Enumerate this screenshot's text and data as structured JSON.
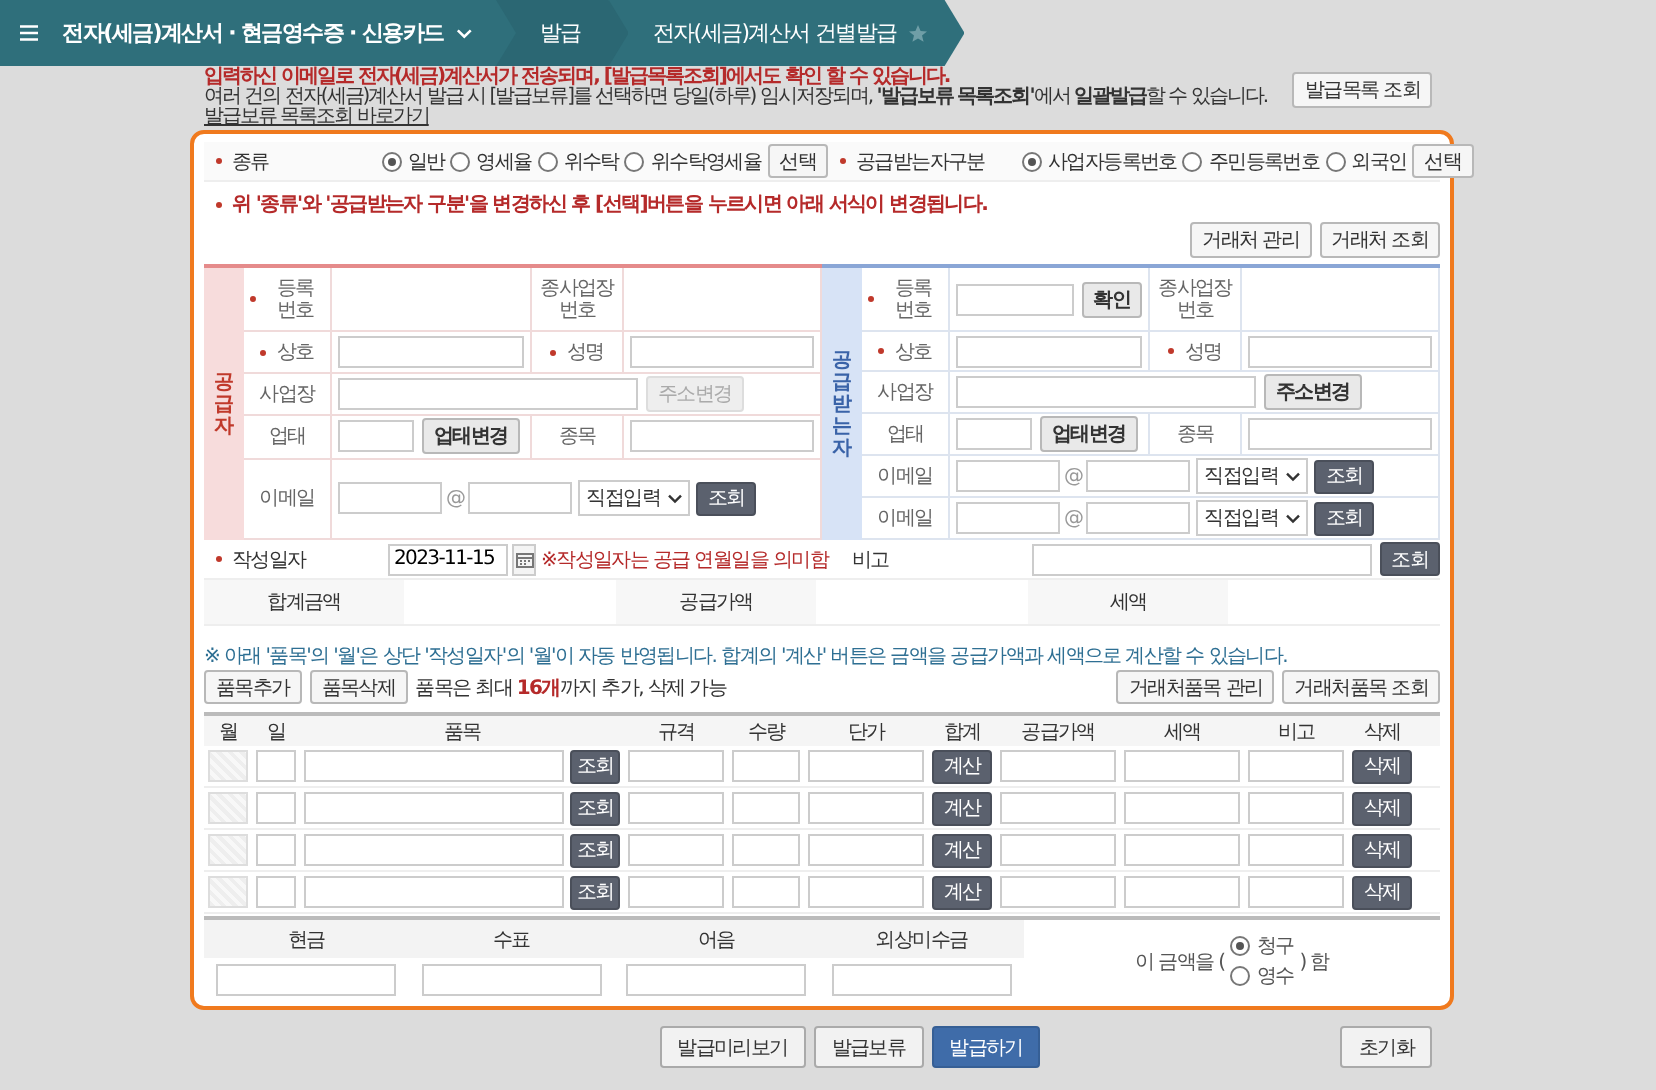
{
  "header": {
    "title": "전자(세금)계산서 · 현금영수증 · 신용카드",
    "crumbs": [
      "발급",
      "전자(세금)계산서 건별발급"
    ]
  },
  "notice": {
    "alert": "입력하신 이메일로 전자(세금)계산서가 전송되며, [발급목록조회]에서도 확인 할 수 있습니다.",
    "info": "여러 건의 전자(세금)계산서 발급 시 [발급보류]를 선택하면 당일(하루) 임시저장되며, **'발급보류 목록조회'**에서 **일괄발급**할 수 있습니다.",
    "link": "발급보류 목록조회 바로가기",
    "list_button": "발급목록 조회"
  },
  "kind_row": {
    "label": "종류",
    "required": true,
    "options": [
      {
        "label": "일반",
        "selected": true
      },
      {
        "label": "영세율",
        "selected": false
      },
      {
        "label": "위수탁",
        "selected": false
      },
      {
        "label": "위수탁영세율",
        "selected": false
      }
    ],
    "button": "선택"
  },
  "recipient_row": {
    "label": "공급받는자구분",
    "required": true,
    "options": [
      {
        "label": "사업자등록번호",
        "selected": true
      },
      {
        "label": "주민등록번호",
        "selected": false
      },
      {
        "label": "외국인",
        "selected": false
      }
    ],
    "button": "선택"
  },
  "change_notice": "위 '종류'와 '공급받는자 구분'을 변경하신 후 [선택]버튼을 누르시면 아래 서식이 변경됩니다.",
  "partner_buttons": [
    "거래처 관리",
    "거래처 조회"
  ],
  "supplier": {
    "title": "공급자",
    "reg": {
      "label": "등록 번호",
      "required": true
    },
    "branch": {
      "label": "종사업장 번호",
      "required": false
    },
    "name": {
      "label": "상호",
      "required": true
    },
    "ceo": {
      "label": "성명",
      "required": true
    },
    "addr": {
      "label": "사업장",
      "required": false,
      "button": "주소변경",
      "disabled": true
    },
    "biz": {
      "label": "업태",
      "required": false,
      "button": "업태변경"
    },
    "item": {
      "label": "종목",
      "required": false
    },
    "emails": [
      {
        "label": "이메일",
        "at": "@",
        "select": "직접입력",
        "button": "조회"
      }
    ]
  },
  "receiver": {
    "title": "공급받는자",
    "reg": {
      "label": "등록 번호",
      "required": true,
      "button": "확인"
    },
    "branch": {
      "label": "종사업장 번호",
      "required": false
    },
    "name": {
      "label": "상호",
      "required": true
    },
    "ceo": {
      "label": "성명",
      "required": true
    },
    "addr": {
      "label": "사업장",
      "required": false,
      "button": "주소변경",
      "disabled": false
    },
    "biz": {
      "label": "업태",
      "required": false,
      "button": "업태변경"
    },
    "item": {
      "label": "종목",
      "required": false
    },
    "emails": [
      {
        "label": "이메일",
        "at": "@",
        "select": "직접입력",
        "button": "조회"
      },
      {
        "label": "이메일",
        "at": "@",
        "select": "직접입력",
        "button": "조회"
      }
    ]
  },
  "date_row": {
    "label": "작성일자",
    "required": true,
    "value": "2023-11-15",
    "hint": "※작성일자는 공급 연월일을 의미함",
    "remark_label": "비고",
    "remark_button": "조회"
  },
  "totals": [
    "합계금액",
    "공급가액",
    "세액"
  ],
  "items_notice": "※ 아래 '품목'의 '월'은 상단 '작성일자'의 '월'이 자동 반영됩니다. 합계의 '계산' 버튼은 금액을 공급가액과 세액으로 계산할 수 있습니다.",
  "item_buttons": [
    "품목추가",
    "품목삭제"
  ],
  "item_limit": "품목은 최대 **16개**까지 추가, 삭제 가능",
  "item_partner_buttons": [
    "거래처품목 관리",
    "거래처품목 조회"
  ],
  "columns": [
    "월",
    "일",
    "품목",
    "규격",
    "수량",
    "단가",
    "합계",
    "공급가액",
    "세액",
    "비고",
    "삭제"
  ],
  "rows": [
    {
      "lookup": "조회",
      "calc": "계산",
      "delete": "삭제"
    },
    {
      "lookup": "조회",
      "calc": "계산",
      "delete": "삭제"
    },
    {
      "lookup": "조회",
      "calc": "계산",
      "delete": "삭제"
    },
    {
      "lookup": "조회",
      "calc": "계산",
      "delete": "삭제"
    }
  ],
  "payment": [
    "현금",
    "수표",
    "어음",
    "외상미수금"
  ],
  "receipt": {
    "prefix": "이 금액을 (",
    "options": [
      {
        "label": "청구",
        "selected": true
      },
      {
        "label": "영수",
        "selected": false
      }
    ],
    "suffix": ") 함"
  },
  "footer_buttons": [
    {
      "label": "발급미리보기",
      "primary": false
    },
    {
      "label": "발급보류",
      "primary": false
    },
    {
      "label": "발급하기",
      "primary": true
    }
  ],
  "reset_button": "초기화"
}
